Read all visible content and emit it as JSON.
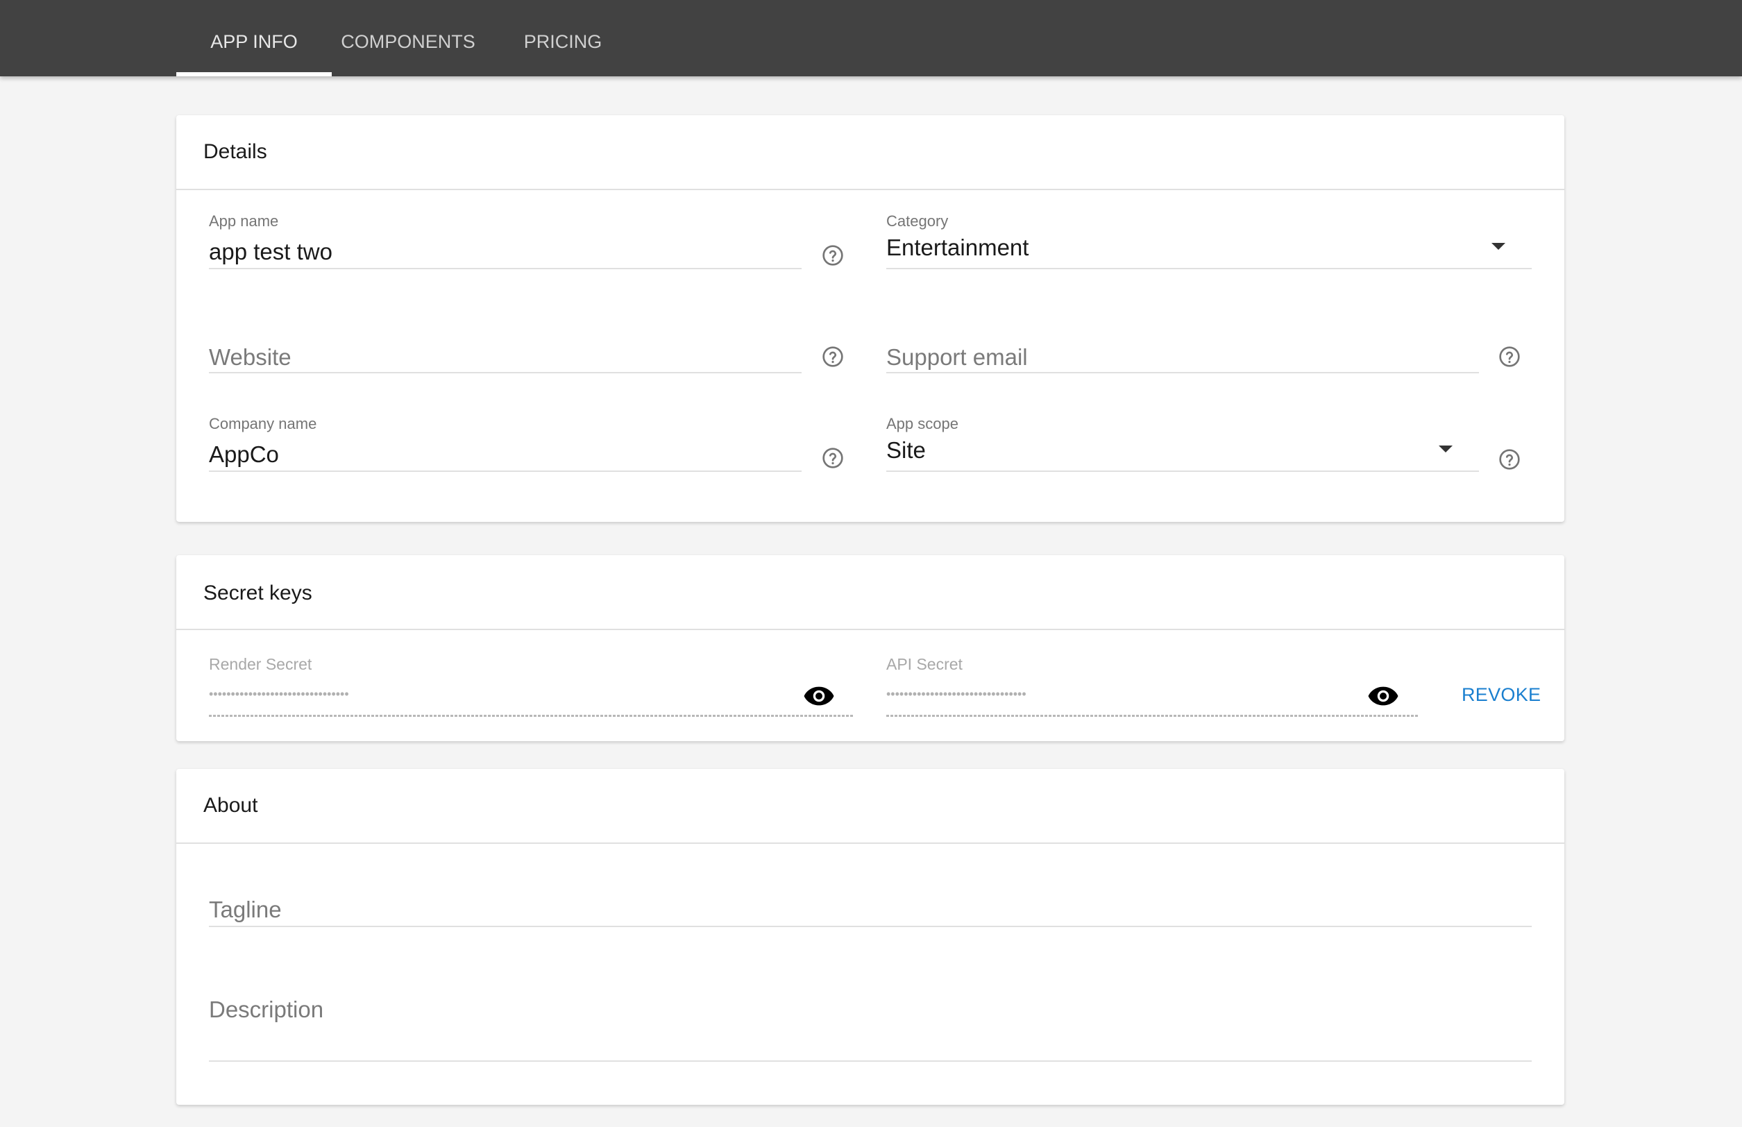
{
  "tabs": [
    {
      "label": "APP INFO",
      "active": true
    },
    {
      "label": "COMPONENTS",
      "active": false
    },
    {
      "label": "PRICING",
      "active": false
    }
  ],
  "details": {
    "title": "Details",
    "app_name": {
      "label": "App name",
      "value": "app test two",
      "help_icon": "help-circle-icon"
    },
    "category": {
      "label": "Category",
      "value": "Entertainment",
      "icon": "caret-down-icon"
    },
    "website": {
      "placeholder": "Website",
      "value": "",
      "help_icon": "help-circle-icon"
    },
    "support_email": {
      "placeholder": "Support email",
      "value": "",
      "help_icon": "help-circle-icon"
    },
    "company_name": {
      "label": "Company name",
      "value": "AppCo",
      "help_icon": "help-circle-icon"
    },
    "app_scope": {
      "label": "App scope",
      "value": "Site",
      "icon": "caret-down-icon",
      "help_icon": "help-circle-icon"
    }
  },
  "secret_keys": {
    "title": "Secret keys",
    "render_secret": {
      "label": "Render Secret",
      "masked_value": "••••••••••••••••••••••••••••••••",
      "toggle_icon": "eye-icon"
    },
    "api_secret": {
      "label": "API Secret",
      "masked_value": "••••••••••••••••••••••••••••••••",
      "toggle_icon": "eye-icon"
    },
    "revoke_label": "REVOKE"
  },
  "about": {
    "title": "About",
    "tagline": {
      "placeholder": "Tagline",
      "value": ""
    },
    "description": {
      "placeholder": "Description",
      "value": ""
    }
  },
  "colors": {
    "topbar": "#424242",
    "background": "#f4f4f4",
    "accent_link": "#1a7fcf",
    "tab_indicator": "#ffffff"
  }
}
